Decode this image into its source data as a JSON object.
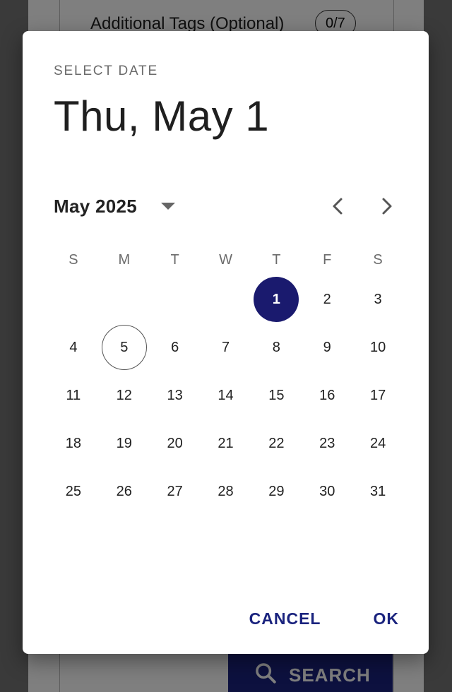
{
  "background": {
    "tags_label": "Additional Tags (Optional)",
    "tags_count": "0/7",
    "search_label": "SEARCH"
  },
  "dialog": {
    "overline": "SELECT DATE",
    "headline": "Thu, May 1",
    "month_label": "May 2025",
    "weekdays": [
      "S",
      "M",
      "T",
      "W",
      "T",
      "F",
      "S"
    ],
    "weeks": [
      [
        "",
        "",
        "",
        "",
        "1",
        "2",
        "3"
      ],
      [
        "4",
        "5",
        "6",
        "7",
        "8",
        "9",
        "10"
      ],
      [
        "11",
        "12",
        "13",
        "14",
        "15",
        "16",
        "17"
      ],
      [
        "18",
        "19",
        "20",
        "21",
        "22",
        "23",
        "24"
      ],
      [
        "25",
        "26",
        "27",
        "28",
        "29",
        "30",
        "31"
      ]
    ],
    "selected_day": "1",
    "today_day": "5",
    "cancel_label": "CANCEL",
    "ok_label": "OK"
  },
  "colors": {
    "primary": "#1a237e",
    "selected_fill": "#1a1a6e",
    "scrim": "rgba(0,0,0,0.5)"
  },
  "icons": {
    "month_dropdown": "arrow-drop-down-icon",
    "prev": "chevron-left-icon",
    "next": "chevron-right-icon",
    "search": "search-icon"
  }
}
